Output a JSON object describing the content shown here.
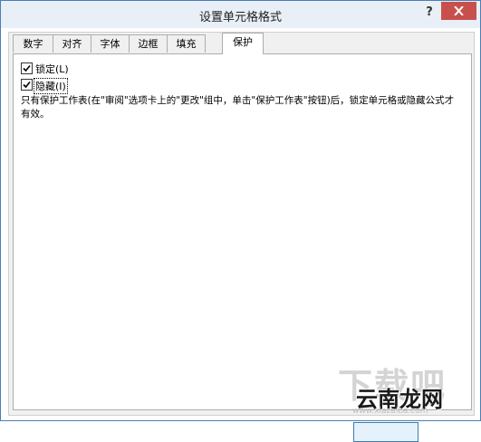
{
  "window": {
    "title": "设置单元格格式",
    "help_label": "?"
  },
  "tabs": [
    {
      "label": "数字"
    },
    {
      "label": "对齐"
    },
    {
      "label": "字体"
    },
    {
      "label": "边框"
    },
    {
      "label": "填充"
    },
    {
      "label": "保护"
    }
  ],
  "active_tab": "保护",
  "protection": {
    "locked": {
      "label": "锁定(L)",
      "checked": true
    },
    "hidden": {
      "label": "隐藏(I)",
      "checked": true
    },
    "description": "只有保护工作表(在\"审阅\"选项卡上的\"更改\"组中，单击\"保护工作表\"按钮)后，锁定单元格或隐藏公式才有效。"
  },
  "watermark": {
    "text": "云南龙网",
    "faint_text": "下载吧",
    "url": "www.xiazaiba.com"
  },
  "icons": {
    "close": "close-icon",
    "check": "checkmark-icon"
  },
  "colors": {
    "close_button": "#c7504d",
    "title_bar": "#e9eff6",
    "dialog_border": "#4a7fb8",
    "ok_button_border": "#3c7fb1"
  }
}
